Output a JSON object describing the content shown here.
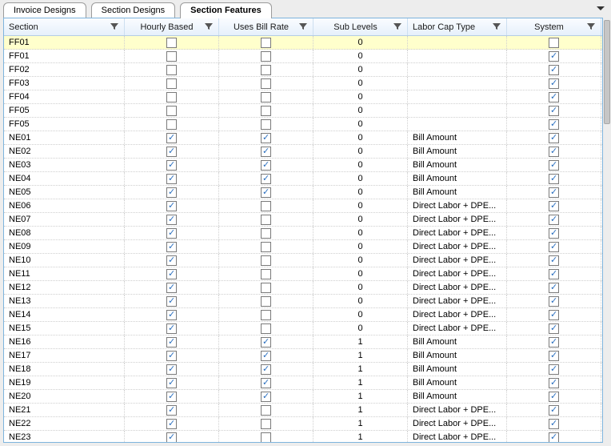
{
  "tabs": [
    {
      "label": "Invoice Designs",
      "active": false
    },
    {
      "label": "Section Designs",
      "active": false
    },
    {
      "label": "Section Features",
      "active": true
    }
  ],
  "columns": {
    "section": "Section",
    "hourly": "Hourly Based",
    "bill": "Uses Bill Rate",
    "sub": "Sub Levels",
    "cap": "Labor Cap Type",
    "system": "System"
  },
  "rows": [
    {
      "section": "FF01",
      "hourly": false,
      "bill": false,
      "sub": "0",
      "cap": "",
      "system": false,
      "selected": true
    },
    {
      "section": "FF01",
      "hourly": false,
      "bill": false,
      "sub": "0",
      "cap": "",
      "system": true
    },
    {
      "section": "FF02",
      "hourly": false,
      "bill": false,
      "sub": "0",
      "cap": "",
      "system": true
    },
    {
      "section": "FF03",
      "hourly": false,
      "bill": false,
      "sub": "0",
      "cap": "",
      "system": true
    },
    {
      "section": "FF04",
      "hourly": false,
      "bill": false,
      "sub": "0",
      "cap": "",
      "system": true
    },
    {
      "section": "FF05",
      "hourly": false,
      "bill": false,
      "sub": "0",
      "cap": "",
      "system": true
    },
    {
      "section": "FF05",
      "hourly": false,
      "bill": false,
      "sub": "0",
      "cap": "",
      "system": true
    },
    {
      "section": "NE01",
      "hourly": true,
      "bill": true,
      "sub": "0",
      "cap": "Bill Amount",
      "system": true
    },
    {
      "section": "NE02",
      "hourly": true,
      "bill": true,
      "sub": "0",
      "cap": "Bill Amount",
      "system": true
    },
    {
      "section": "NE03",
      "hourly": true,
      "bill": true,
      "sub": "0",
      "cap": "Bill Amount",
      "system": true
    },
    {
      "section": "NE04",
      "hourly": true,
      "bill": true,
      "sub": "0",
      "cap": "Bill Amount",
      "system": true
    },
    {
      "section": "NE05",
      "hourly": true,
      "bill": true,
      "sub": "0",
      "cap": "Bill Amount",
      "system": true
    },
    {
      "section": "NE06",
      "hourly": true,
      "bill": false,
      "sub": "0",
      "cap": "Direct Labor + DPE...",
      "system": true
    },
    {
      "section": "NE07",
      "hourly": true,
      "bill": false,
      "sub": "0",
      "cap": "Direct Labor + DPE...",
      "system": true
    },
    {
      "section": "NE08",
      "hourly": true,
      "bill": false,
      "sub": "0",
      "cap": "Direct Labor + DPE...",
      "system": true
    },
    {
      "section": "NE09",
      "hourly": true,
      "bill": false,
      "sub": "0",
      "cap": "Direct Labor + DPE...",
      "system": true
    },
    {
      "section": "NE10",
      "hourly": true,
      "bill": false,
      "sub": "0",
      "cap": "Direct Labor + DPE...",
      "system": true
    },
    {
      "section": "NE11",
      "hourly": true,
      "bill": false,
      "sub": "0",
      "cap": "Direct Labor + DPE...",
      "system": true
    },
    {
      "section": "NE12",
      "hourly": true,
      "bill": false,
      "sub": "0",
      "cap": "Direct Labor + DPE...",
      "system": true
    },
    {
      "section": "NE13",
      "hourly": true,
      "bill": false,
      "sub": "0",
      "cap": "Direct Labor + DPE...",
      "system": true
    },
    {
      "section": "NE14",
      "hourly": true,
      "bill": false,
      "sub": "0",
      "cap": "Direct Labor + DPE...",
      "system": true
    },
    {
      "section": "NE15",
      "hourly": true,
      "bill": false,
      "sub": "0",
      "cap": "Direct Labor + DPE...",
      "system": true
    },
    {
      "section": "NE16",
      "hourly": true,
      "bill": true,
      "sub": "1",
      "cap": "Bill Amount",
      "system": true
    },
    {
      "section": "NE17",
      "hourly": true,
      "bill": true,
      "sub": "1",
      "cap": "Bill Amount",
      "system": true
    },
    {
      "section": "NE18",
      "hourly": true,
      "bill": true,
      "sub": "1",
      "cap": "Bill Amount",
      "system": true
    },
    {
      "section": "NE19",
      "hourly": true,
      "bill": true,
      "sub": "1",
      "cap": "Bill Amount",
      "system": true
    },
    {
      "section": "NE20",
      "hourly": true,
      "bill": true,
      "sub": "1",
      "cap": "Bill Amount",
      "system": true
    },
    {
      "section": "NE21",
      "hourly": true,
      "bill": false,
      "sub": "1",
      "cap": "Direct Labor + DPE...",
      "system": true
    },
    {
      "section": "NE22",
      "hourly": true,
      "bill": false,
      "sub": "1",
      "cap": "Direct Labor + DPE...",
      "system": true
    },
    {
      "section": "NE23",
      "hourly": true,
      "bill": false,
      "sub": "1",
      "cap": "Direct Labor + DPE...",
      "system": true
    }
  ]
}
